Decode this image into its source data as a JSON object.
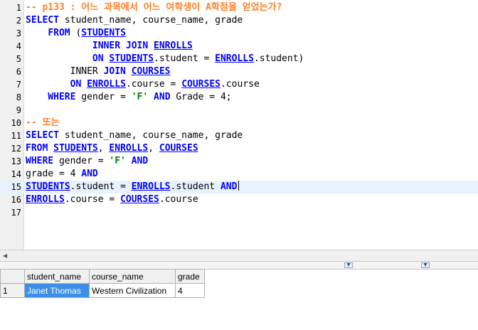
{
  "editor": {
    "lines": [
      {
        "n": "1",
        "tokens": [
          {
            "t": "-- p133 : 어느 과목에서 어느 여학생이 A학점을 얻었는가?",
            "c": "cmt"
          }
        ]
      },
      {
        "n": "2",
        "tokens": [
          {
            "t": "SELECT",
            "c": "kw"
          },
          {
            "t": " student_name, course_name, grade",
            "c": ""
          }
        ]
      },
      {
        "n": "3",
        "tokens": [
          {
            "t": "    ",
            "c": ""
          },
          {
            "t": "FROM",
            "c": "kw"
          },
          {
            "t": " (",
            "c": ""
          },
          {
            "t": "STUDENTS",
            "c": "tbl"
          }
        ]
      },
      {
        "n": "4",
        "tokens": [
          {
            "t": "            INNER JOIN",
            "c": "kw"
          },
          {
            "t": " ",
            "c": ""
          },
          {
            "t": "ENROLLS",
            "c": "tbl"
          }
        ]
      },
      {
        "n": "5",
        "tokens": [
          {
            "t": "            ON",
            "c": "kw"
          },
          {
            "t": " ",
            "c": ""
          },
          {
            "t": "STUDENTS",
            "c": "tbl"
          },
          {
            "t": ".student = ",
            "c": ""
          },
          {
            "t": "ENROLLS",
            "c": "tbl"
          },
          {
            "t": ".student)",
            "c": ""
          }
        ]
      },
      {
        "n": "6",
        "tokens": [
          {
            "t": "        INNER",
            "c": ""
          },
          {
            "t": " JOIN",
            "c": "kw"
          },
          {
            "t": " ",
            "c": ""
          },
          {
            "t": "COURSES",
            "c": "tbl"
          }
        ]
      },
      {
        "n": "7",
        "tokens": [
          {
            "t": "        ON",
            "c": "kw"
          },
          {
            "t": " ",
            "c": ""
          },
          {
            "t": "ENROLLS",
            "c": "tbl"
          },
          {
            "t": ".course = ",
            "c": ""
          },
          {
            "t": "COURSES",
            "c": "tbl"
          },
          {
            "t": ".course",
            "c": ""
          }
        ]
      },
      {
        "n": "8",
        "tokens": [
          {
            "t": "    WHERE",
            "c": "kw"
          },
          {
            "t": " gender = ",
            "c": ""
          },
          {
            "t": "'F'",
            "c": "str"
          },
          {
            "t": " ",
            "c": ""
          },
          {
            "t": "AND",
            "c": "kw"
          },
          {
            "t": " Grade = 4;",
            "c": ""
          }
        ]
      },
      {
        "n": "9",
        "tokens": []
      },
      {
        "n": "10",
        "tokens": [
          {
            "t": "-- 또는",
            "c": "cmt"
          }
        ]
      },
      {
        "n": "11",
        "tokens": [
          {
            "t": "SELECT",
            "c": "kw"
          },
          {
            "t": " student_name, course_name, grade",
            "c": ""
          }
        ]
      },
      {
        "n": "12",
        "tokens": [
          {
            "t": "FROM",
            "c": "kw"
          },
          {
            "t": " ",
            "c": ""
          },
          {
            "t": "STUDENTS",
            "c": "tbl"
          },
          {
            "t": ", ",
            "c": ""
          },
          {
            "t": "ENROLLS",
            "c": "tbl"
          },
          {
            "t": ", ",
            "c": ""
          },
          {
            "t": "COURSES",
            "c": "tbl"
          }
        ]
      },
      {
        "n": "13",
        "tokens": [
          {
            "t": "WHERE",
            "c": "kw"
          },
          {
            "t": " gender = ",
            "c": ""
          },
          {
            "t": "'F'",
            "c": "str"
          },
          {
            "t": " ",
            "c": ""
          },
          {
            "t": "AND",
            "c": "kw"
          }
        ]
      },
      {
        "n": "14",
        "tokens": [
          {
            "t": "grade = 4 ",
            "c": ""
          },
          {
            "t": "AND",
            "c": "kw"
          }
        ]
      },
      {
        "n": "15",
        "tokens": [
          {
            "t": "STUDENTS",
            "c": "tbl"
          },
          {
            "t": ".student = ",
            "c": ""
          },
          {
            "t": "ENROLLS",
            "c": "tbl"
          },
          {
            "t": ".student ",
            "c": ""
          },
          {
            "t": "AND",
            "c": "kw"
          }
        ],
        "current": true
      },
      {
        "n": "16",
        "tokens": [
          {
            "t": "ENROLLS",
            "c": "tbl"
          },
          {
            "t": ".course = ",
            "c": ""
          },
          {
            "t": "COURSES",
            "c": "tbl"
          },
          {
            "t": ".course",
            "c": ""
          }
        ]
      },
      {
        "n": "17",
        "tokens": []
      }
    ]
  },
  "results": {
    "columns": [
      "student_name",
      "course_name",
      "grade"
    ],
    "rows": [
      {
        "num": "1",
        "cells": [
          "Janet Thomas",
          "Western Civilization",
          "4"
        ]
      }
    ]
  },
  "icons": {
    "scroll_left": "scroll-left-arrow-icon",
    "dropdown": "dropdown-arrow-icon"
  },
  "colors": {
    "keyword": "#0000ff",
    "string": "#008000",
    "comment": "#ff7f27",
    "selection": "#3c8fe6"
  }
}
